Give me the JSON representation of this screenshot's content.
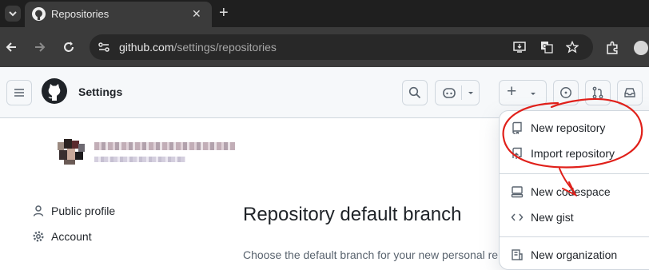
{
  "browser": {
    "tab_title": "Repositories",
    "tab_close": "✕",
    "new_tab": "+",
    "url_host": "github.com",
    "url_path": "/settings/repositories"
  },
  "header": {
    "title": "Settings",
    "create_plus": "+"
  },
  "sidebar": {
    "items": [
      {
        "label": "Public profile",
        "icon": "person-icon"
      },
      {
        "label": "Account",
        "icon": "gear-icon"
      }
    ]
  },
  "main": {
    "heading": "Repository default branch",
    "description": "Choose the default branch for your new personal re"
  },
  "create_menu": {
    "items": [
      {
        "label": "New repository",
        "icon": "repo-icon"
      },
      {
        "label": "Import repository",
        "icon": "repo-push-icon"
      },
      {
        "label": "New codespace",
        "icon": "codespaces-icon"
      },
      {
        "label": "New gist",
        "icon": "code-icon"
      },
      {
        "label": "New organization",
        "icon": "organization-icon"
      }
    ]
  },
  "colors": {
    "chrome_bg": "#1f1f1f",
    "toolbar_bg": "#3b3b3b",
    "annotation_red": "#e0201a"
  }
}
